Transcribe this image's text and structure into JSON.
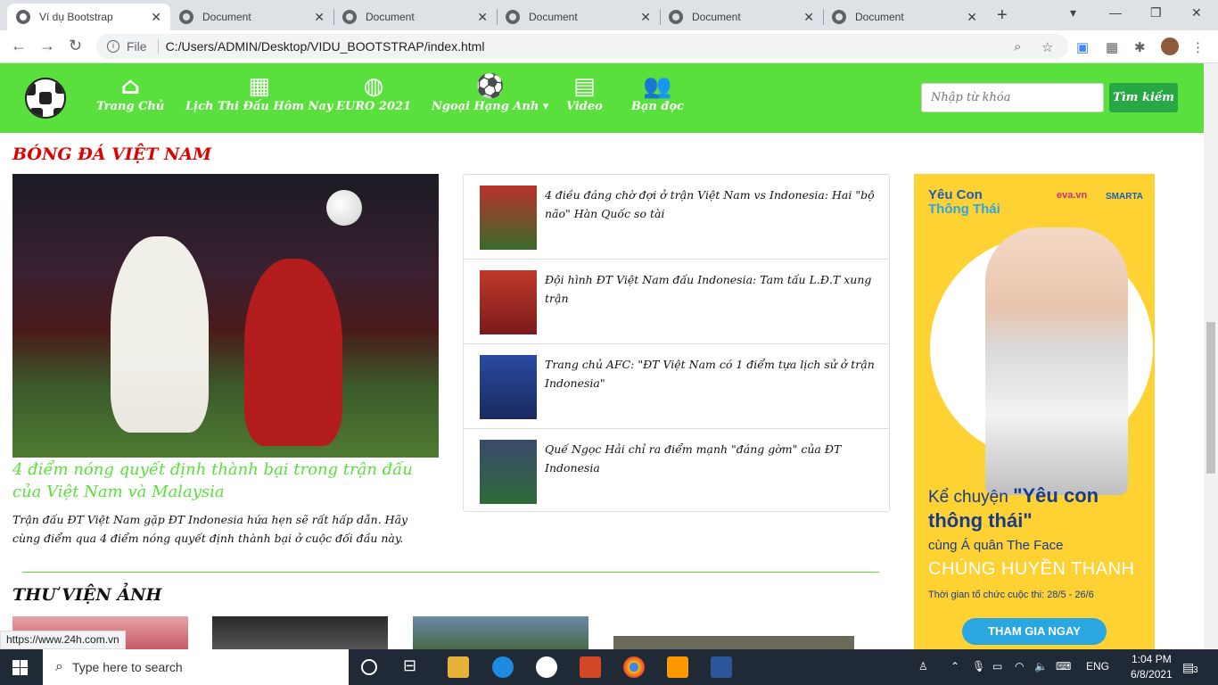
{
  "browser": {
    "tabs": [
      {
        "title": "Ví dụ Bootstrap",
        "active": true
      },
      {
        "title": "Document"
      },
      {
        "title": "Document"
      },
      {
        "title": "Document"
      },
      {
        "title": "Document"
      },
      {
        "title": "Document"
      }
    ],
    "new_tab_glyph": "+",
    "file_label": "File",
    "url": "C:/Users/ADMIN/Desktop/VIDU_BOOTSTRAP/index.html",
    "status_url": "https://www.24h.com.vn"
  },
  "site": {
    "nav": [
      {
        "label": "Trang Chủ",
        "icon": "home-icon"
      },
      {
        "label": "Lịch Thi Đấu Hôm Nay",
        "icon": "calendar-icon"
      },
      {
        "label": "EURO 2021",
        "icon": "globe-icon"
      },
      {
        "label": "Ngoại Hạng Anh",
        "icon": "football-icon"
      },
      {
        "label": "Video",
        "icon": "film-icon"
      },
      {
        "label": "Bạn đọc",
        "icon": "users-icon"
      }
    ],
    "search_placeholder": "Nhập từ khóa",
    "search_button": "Tìm kiếm",
    "brand_color": "#5ae03c"
  },
  "section_vn": {
    "title": "BÓNG ĐÁ VIỆT NAM",
    "hero_title": "4 điểm nóng quyết định thành bại trong trận đấu của Việt Nam và Malaysia",
    "hero_desc": "Trận đấu ĐT Việt Nam gặp ĐT Indonesia hứa hẹn sẽ rất hấp dẫn. Hãy cùng điểm qua 4 điểm nóng quyết định thành bại ở cuộc đối đầu này.",
    "news": [
      {
        "text": "4 điều đáng chờ đợi ở trận Việt Nam vs Indonesia: Hai \"bộ não\" Hàn Quốc so tài"
      },
      {
        "text": "Đội hình ĐT Việt Nam đấu Indonesia: Tam tấu L.Đ.T xung trận"
      },
      {
        "text": "Trang chủ AFC: \"ĐT Việt Nam có 1 điểm tựa lịch sử ở trận Indonesia\""
      },
      {
        "text": "Quế Ngọc Hải chỉ ra điểm mạnh \"đáng gờm\" của ĐT Indonesia"
      }
    ]
  },
  "ad": {
    "brand_line1": "Yêu Con",
    "brand_line2": "Thông Thái",
    "partner1": "eva.vn",
    "partner2": "SMARTA",
    "line1_prefix": "Kể chuyện",
    "line1_quote": "\"Yêu con",
    "line2": "thông thái\"",
    "line3": "cùng Á quân The Face",
    "line4": "CHÚNG HUYỀN THANH",
    "line5": "Thời gian tổ chức cuộc thi: 28/5 - 26/6",
    "cta": "THAM GIA NGAY"
  },
  "section_gallery": {
    "title": "THƯ VIỆN ẢNH"
  },
  "taskbar": {
    "search_placeholder": "Type here to search",
    "lang": "ENG",
    "time": "1:04 PM",
    "date": "6/8/2021",
    "notif_count": "3"
  }
}
